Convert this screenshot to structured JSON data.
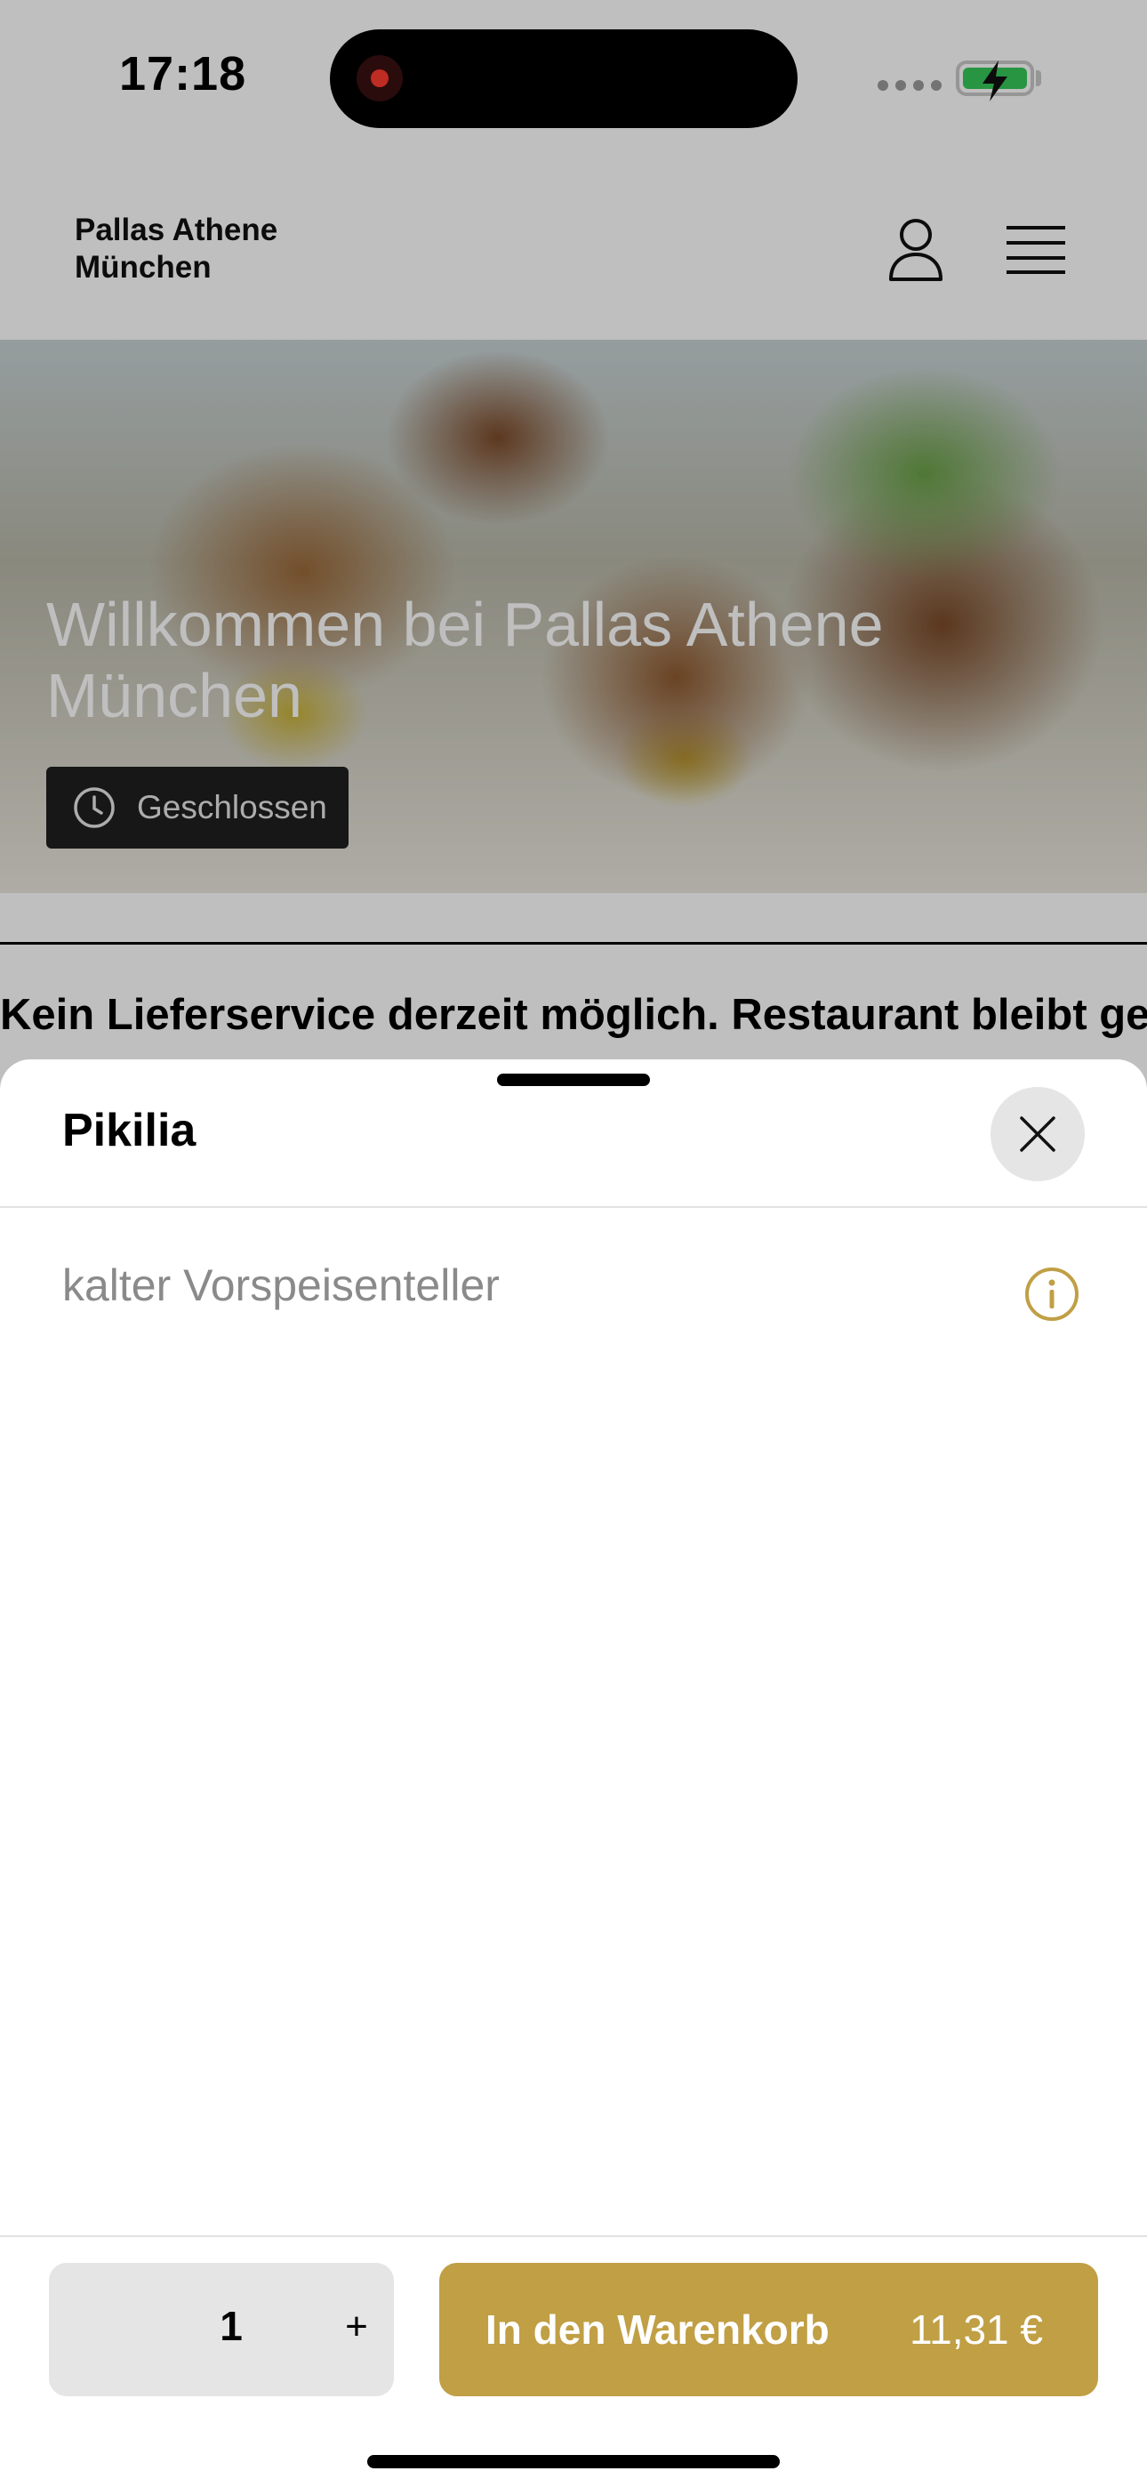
{
  "status_bar": {
    "time": "17:18",
    "battery_charging": true
  },
  "header": {
    "brand_line1": "Pallas Athene",
    "brand_line2": "München",
    "icons": [
      "user-icon",
      "menu-icon"
    ]
  },
  "hero": {
    "title": "Willkommen bei Pallas Athene München",
    "status_badge": "Geschlossen"
  },
  "notice": {
    "text": "Kein Lieferservice derzeit möglich. Restaurant bleibt geöffnet. Abholung & zu Gut-Essen möglich"
  },
  "sheet": {
    "title": "Pikilia",
    "description": "kalter Vorspeisenteller",
    "quantity": "1",
    "plus_label": "+",
    "add_to_cart_label": "In den Warenkorb",
    "price": "11,31 €"
  },
  "colors": {
    "accent": "#c09f45",
    "scrim": "rgba(0,0,0,0.25)",
    "badge_bg": "#1f1f1f"
  }
}
